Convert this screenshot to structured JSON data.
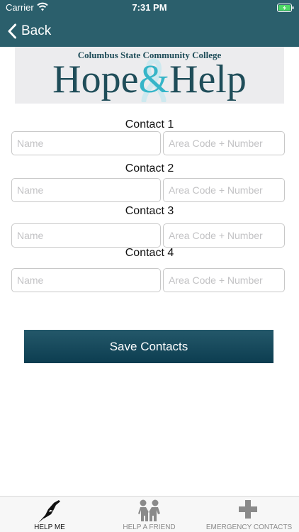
{
  "status_bar": {
    "carrier": "Carrier",
    "time": "7:31 PM"
  },
  "nav": {
    "back_label": "Back"
  },
  "banner": {
    "subtitle": "Columbus State Community College",
    "title_part1": "Hope",
    "title_amp": "&",
    "title_part2": "Help"
  },
  "contacts": [
    {
      "label": "Contact 1",
      "name_placeholder": "Name",
      "phone_placeholder": "Area Code + Number"
    },
    {
      "label": "Contact 2",
      "name_placeholder": "Name",
      "phone_placeholder": "Area Code + Number"
    },
    {
      "label": "Contact 3",
      "name_placeholder": "Name",
      "phone_placeholder": "Area Code + Number"
    },
    {
      "label": "Contact 4",
      "name_placeholder": "Name",
      "phone_placeholder": "Area Code + Number"
    }
  ],
  "save_label": "Save Contacts",
  "tabs": [
    {
      "label": "HELP ME",
      "icon": "hands-icon",
      "active": true
    },
    {
      "label": "HELP A FRIEND",
      "icon": "friends-icon",
      "active": false
    },
    {
      "label": "EMERGENCY CONTACTS",
      "icon": "medical-cross-icon",
      "active": false
    }
  ],
  "colors": {
    "nav_bar": "#2b5f6c",
    "accent": "#36b5c8",
    "button": "#0c3d50",
    "tab_active": "#111111",
    "tab_inactive": "#8a8a8a"
  }
}
